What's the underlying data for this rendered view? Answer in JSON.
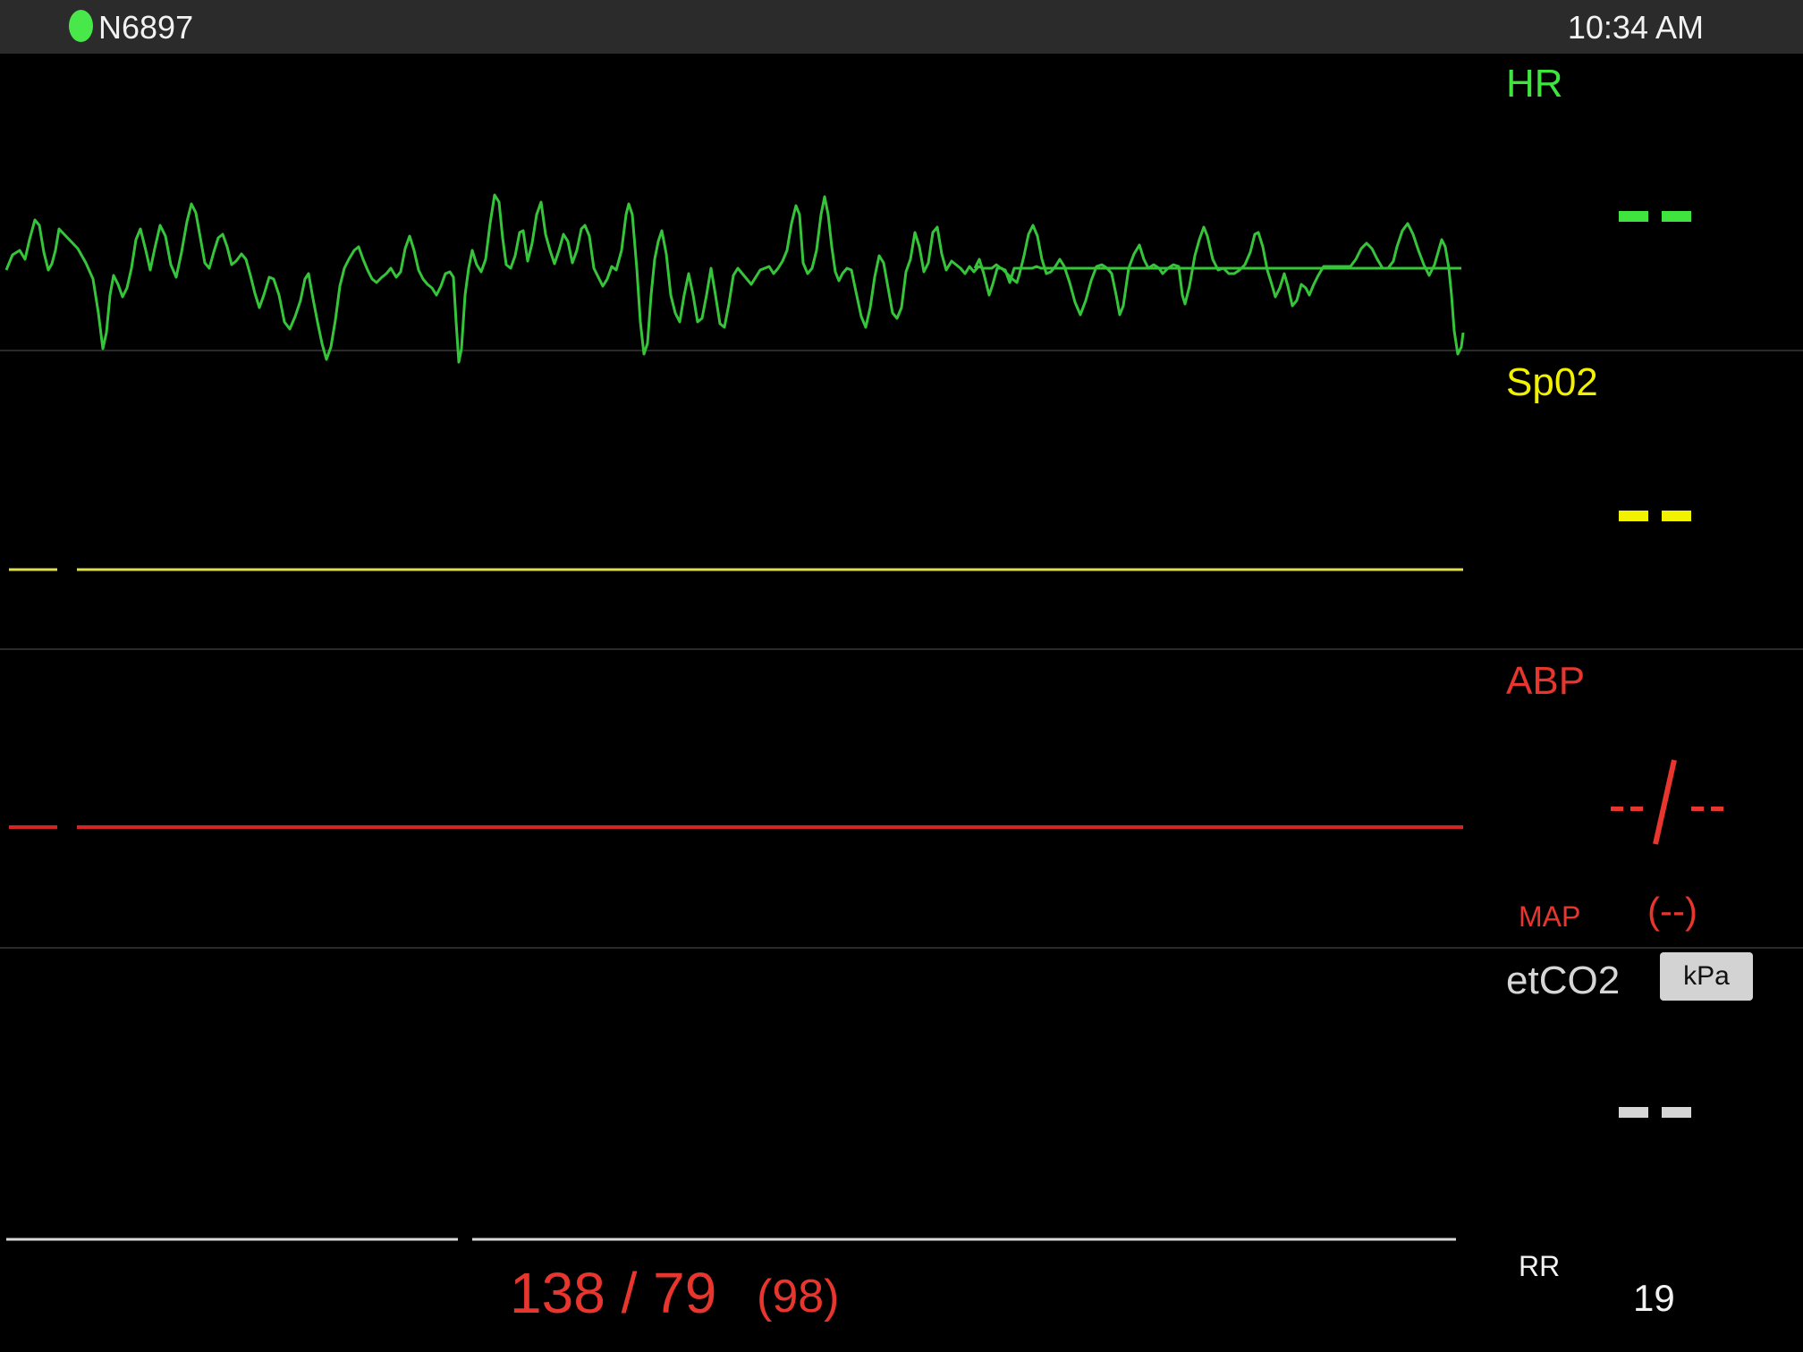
{
  "status": {
    "device_id": "N6897",
    "connection_color": "#49e84a",
    "time": "10:34 AM"
  },
  "channels": {
    "hr": {
      "label": "HR",
      "value": "--",
      "color": "#3fe43f"
    },
    "spo2": {
      "label": "Sp02",
      "value": "--",
      "color": "#f2f200"
    },
    "abp": {
      "label": "ABP",
      "value": "--/--",
      "map_label": "MAP",
      "map_value": "(--)",
      "color": "#e8362e"
    },
    "etco2": {
      "label": "etCO2",
      "value": "--",
      "unit_button": "kPa",
      "rr_label": "RR",
      "rr_value": "19",
      "color": "#d6d6d6"
    }
  },
  "bp_readout": {
    "value": "138 / 79",
    "map": "(98)",
    "color": "#e8362e"
  }
}
